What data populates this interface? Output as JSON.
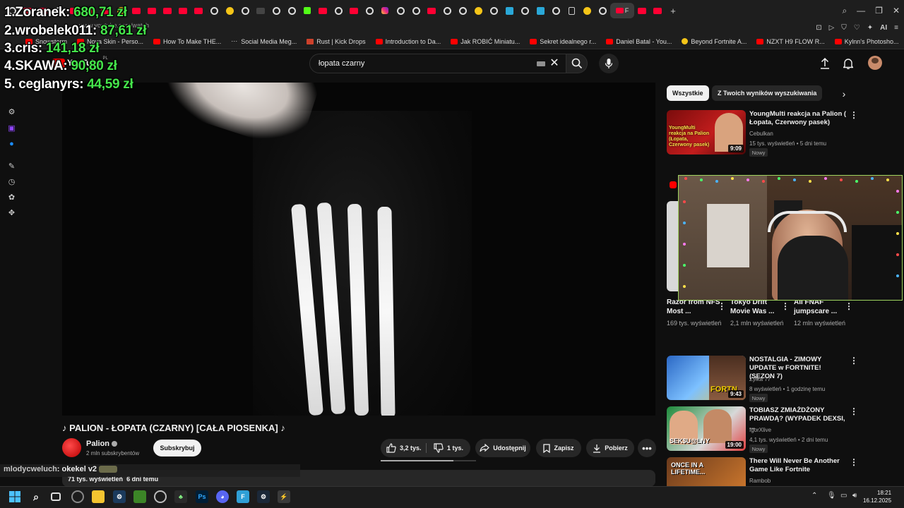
{
  "stream_overlay": {
    "leaderboard": [
      {
        "rank_name": "1.Zoranek:",
        "amount": "680,71 zł"
      },
      {
        "rank_name": "2.wrobelek011:",
        "amount": "87,61 zł"
      },
      {
        "rank_name": "3.cris:",
        "amount": "141,18 zł"
      },
      {
        "rank_name": "4.SKAWA:",
        "amount": "90,80 zł"
      },
      {
        "rank_name": "5. ceglanyrs:",
        "amount": "44,59 zł"
      }
    ],
    "chat": {
      "user": "mlodycweluch",
      "message": ": okekel v2"
    }
  },
  "browser": {
    "active_tab_label": "F",
    "url": "www.youtube.com/watch",
    "bookmarks": [
      "Snowstorm",
      "Nova Skin - Perso...",
      "How To Make THE...",
      "Social Media Meg...",
      "Rust | Kick Drops",
      "Introduction to Da...",
      "Jak ROBIĆ Miniatu...",
      "Sekret idealnego r...",
      "Daniel Batal - You...",
      "Beyond Fortnite A...",
      "NZXT H9 FLOW R...",
      "Kylnn's Photosho..."
    ],
    "ai_label": "AI"
  },
  "youtube": {
    "logo_text": "YouTube",
    "logo_country": "PL",
    "search": {
      "value": "łopata czarny"
    },
    "video": {
      "title": "♪ PALION - ŁOPATA (CZARNY) [CAŁA PIOSENKA] ♪",
      "progress": 0.76,
      "channel": "Palion",
      "subscribers": "2 mln subskrybentów",
      "subscribe_label": "Subskrybuj",
      "likes": "3,2 tys.",
      "dislikes": "1 tys.",
      "share_label": "Udostępnij",
      "save_label": "Zapisz",
      "download_label": "Pobierz",
      "views": "71 tys. wyświetleń",
      "age": "6 dni temu"
    },
    "chips": [
      "Wszystkie",
      "Z Twoich wyników wyszukiwania"
    ],
    "recommendations": [
      {
        "title": "YoungMulti reakcja na Palion ( Łopata, Czerwony pasek)",
        "channel": "Cebulkan",
        "meta": "15 tys. wyświetleń • 5 dni temu",
        "duration": "9:09",
        "badge": "Nowy",
        "thumb_text": "YoungMulti reakcja na Palion (Łopata, Czerwony pasek)"
      },
      {
        "title": "NOSTALGIA - ZIMOWY UPDATE w FORTNITE! (SEZON 7)",
        "channel": "Zyłka 77",
        "meta": "8 wyświetleń • 1 godzinę temu",
        "duration": "9:43",
        "badge": "Nowy",
        "thumb_text": "FORTN"
      },
      {
        "title": "TOBIASZ ZMIAŻDŻONY PRAWDĄ? (WYPADEK DEXSI, ...",
        "channel": "IgorXlive",
        "meta": "4,1 tys. wyświetleń • 2 dni temu",
        "duration": "19:00",
        "badge": "Nowy",
        "thumb_text": "SEK$U@LNY"
      },
      {
        "title": "There Will Never Be Another Game Like Fortnite",
        "channel": "Rambob",
        "meta": "",
        "duration": "",
        "badge": "",
        "thumb_text": "ONCE IN A LIFETIME..."
      }
    ],
    "shorts": [
      {
        "title": "Razor from NFS Most ...",
        "views": "169 tys. wyświetleń"
      },
      {
        "title": "Tokyo Drift Movie Was ...",
        "views": "2,1 mln wyświetleń"
      },
      {
        "title": "All FNAF jumpscare ...",
        "views": "12 mln wyświetleń"
      }
    ]
  },
  "taskbar": {
    "time": "18:21",
    "date": "16.12.2025",
    "ps_label": "Ps"
  }
}
